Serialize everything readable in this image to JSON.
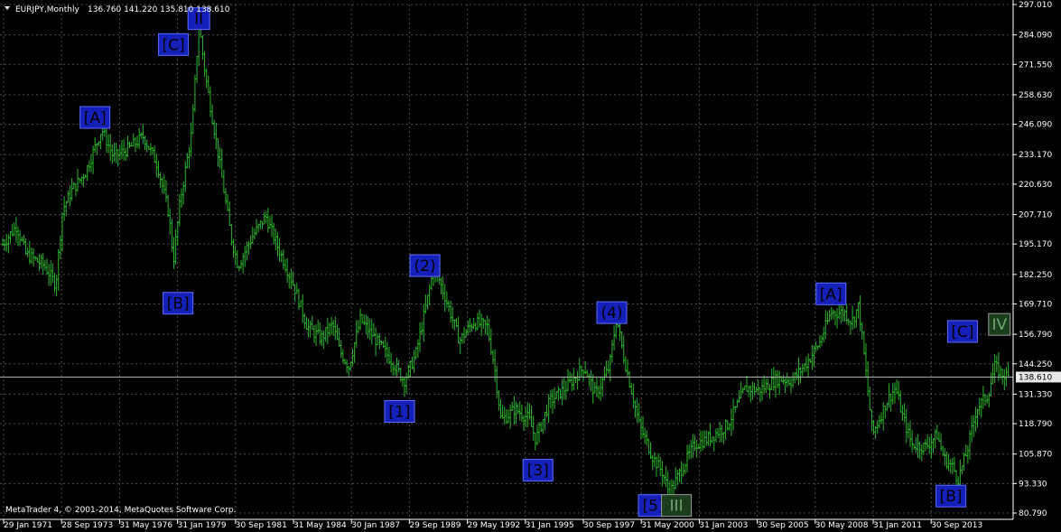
{
  "header": {
    "symbol": "EURJPY,Monthly",
    "ohlc": "136.760 141.220 135.810 138.610"
  },
  "footer": {
    "copyright": "MetaTrader 4, © 2001-2014, MetaQuotes Software Corp."
  },
  "colors": {
    "background": "#000000",
    "bars": "#2db52d",
    "grid": "#8a8a8a",
    "label_box": "#1520b8",
    "current_line": "#b0b0b0"
  },
  "chart_data": {
    "type": "bar",
    "title": "EURJPY,Monthly",
    "y_ticks": [
      "297.010",
      "284.090",
      "271.550",
      "258.630",
      "246.090",
      "233.170",
      "220.630",
      "207.710",
      "195.170",
      "182.250",
      "169.710",
      "156.790",
      "144.250",
      "131.330",
      "118.790",
      "105.870",
      "93.330",
      "80.790"
    ],
    "y_range": [
      80.79,
      297.01
    ],
    "x_ticks": [
      "29 Jan 1971",
      "28 Sep 1973",
      "31 May 1976",
      "31 Jan 1979",
      "30 Sep 1981",
      "31 May 1984",
      "30 Jan 1987",
      "29 Sep 1989",
      "29 May 1992",
      "31 Jan 1995",
      "30 Sep 1997",
      "31 May 2000",
      "31 Jan 2003",
      "30 Sep 2005",
      "30 May 2008",
      "31 Jan 2011",
      "30 Sep 2013"
    ],
    "x_range": [
      1971.0,
      2014.6
    ],
    "current_price": "138.610",
    "price_path": [
      [
        1971.0,
        195
      ],
      [
        1971.6,
        203
      ],
      [
        1972.0,
        191
      ],
      [
        1972.8,
        186
      ],
      [
        1973.3,
        178
      ],
      [
        1973.6,
        210
      ],
      [
        1974.0,
        218
      ],
      [
        1974.6,
        226
      ],
      [
        1975.3,
        244
      ],
      [
        1975.8,
        232
      ],
      [
        1976.5,
        236
      ],
      [
        1977.1,
        241
      ],
      [
        1977.7,
        229
      ],
      [
        1978.2,
        208
      ],
      [
        1978.4,
        188
      ],
      [
        1978.7,
        214
      ],
      [
        1979.2,
        243
      ],
      [
        1979.5,
        289
      ],
      [
        1979.8,
        266
      ],
      [
        1980.3,
        236
      ],
      [
        1980.9,
        198
      ],
      [
        1981.2,
        186
      ],
      [
        1981.8,
        198
      ],
      [
        1982.4,
        207
      ],
      [
        1982.8,
        197
      ],
      [
        1983.6,
        178
      ],
      [
        1984.2,
        160
      ],
      [
        1984.8,
        155
      ],
      [
        1985.3,
        161
      ],
      [
        1985.6,
        150
      ],
      [
        1986.0,
        143
      ],
      [
        1986.5,
        163
      ],
      [
        1987.2,
        154
      ],
      [
        1987.9,
        145
      ],
      [
        1988.4,
        137
      ],
      [
        1988.9,
        148
      ],
      [
        1989.5,
        176
      ],
      [
        1989.7,
        186
      ],
      [
        1990.2,
        172
      ],
      [
        1990.8,
        154
      ],
      [
        1991.4,
        162
      ],
      [
        1992.0,
        160
      ],
      [
        1992.3,
        144
      ],
      [
        1992.6,
        120
      ],
      [
        1993.2,
        125
      ],
      [
        1993.8,
        121
      ],
      [
        1994.1,
        112
      ],
      [
        1994.7,
        128
      ],
      [
        1995.4,
        134
      ],
      [
        1996.2,
        143
      ],
      [
        1996.7,
        131
      ],
      [
        1997.3,
        143
      ],
      [
        1997.6,
        164
      ],
      [
        1997.9,
        148
      ],
      [
        1998.6,
        118
      ],
      [
        1999.2,
        104
      ],
      [
        1999.6,
        98
      ],
      [
        1999.9,
        89
      ],
      [
        2000.5,
        101
      ],
      [
        2001.0,
        110
      ],
      [
        2001.5,
        112
      ],
      [
        2002.4,
        118
      ],
      [
        2003.2,
        134
      ],
      [
        2003.8,
        133
      ],
      [
        2004.6,
        138
      ],
      [
        2005.2,
        137
      ],
      [
        2005.8,
        144
      ],
      [
        2006.4,
        153
      ],
      [
        2006.9,
        166
      ],
      [
        2007.5,
        166
      ],
      [
        2007.8,
        162
      ],
      [
        2008.1,
        169
      ],
      [
        2008.4,
        142
      ],
      [
        2008.7,
        114
      ],
      [
        2009.3,
        128
      ],
      [
        2009.7,
        134
      ],
      [
        2010.0,
        122
      ],
      [
        2010.4,
        110
      ],
      [
        2011.0,
        109
      ],
      [
        2011.5,
        114
      ],
      [
        2011.8,
        104
      ],
      [
        2012.2,
        100
      ],
      [
        2012.4,
        95
      ],
      [
        2012.8,
        107
      ],
      [
        2013.2,
        125
      ],
      [
        2013.7,
        131
      ],
      [
        2014.0,
        143
      ],
      [
        2014.3,
        140
      ],
      [
        2014.6,
        138.6
      ]
    ],
    "wave_labels": [
      {
        "text": "[A]",
        "year": 1975.0,
        "price": 249.0,
        "style": "blue"
      },
      {
        "text": "[C]",
        "year": 1978.4,
        "price": 280.0,
        "style": "blue"
      },
      {
        "text": "II",
        "year": 1979.5,
        "price": 291.0,
        "style": "blue"
      },
      {
        "text": "[B]",
        "year": 1978.6,
        "price": 170.0,
        "style": "blue"
      },
      {
        "text": "(2)",
        "year": 1989.3,
        "price": 186.0,
        "style": "blue"
      },
      {
        "text": "[1]",
        "year": 1988.2,
        "price": 124.0,
        "style": "blue"
      },
      {
        "text": "(4)",
        "year": 1997.4,
        "price": 166.0,
        "style": "blue"
      },
      {
        "text": "[3]",
        "year": 1994.2,
        "price": 99.0,
        "style": "blue"
      },
      {
        "text": "[5]",
        "year": 1999.2,
        "price": 84.0,
        "style": "blue"
      },
      {
        "text": "III",
        "year": 2000.2,
        "price": 84.0,
        "style": "green"
      },
      {
        "text": "[A]",
        "year": 2006.9,
        "price": 174.0,
        "style": "blue"
      },
      {
        "text": "[B]",
        "year": 2012.1,
        "price": 88.0,
        "style": "blue"
      },
      {
        "text": "[C]",
        "year": 2012.6,
        "price": 158.0,
        "style": "blue"
      },
      {
        "text": "IV",
        "year": 2014.2,
        "price": 161.0,
        "style": "green"
      }
    ]
  }
}
